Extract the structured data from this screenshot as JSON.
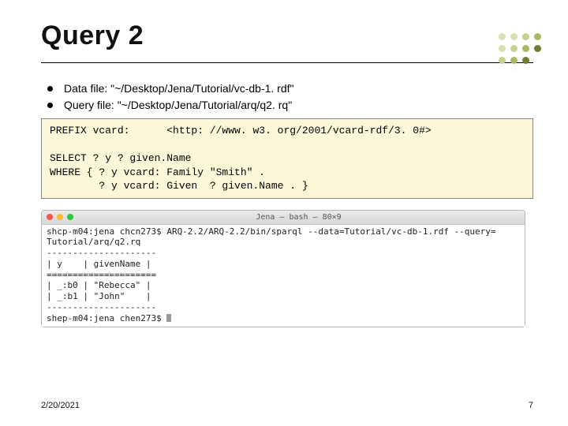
{
  "title": "Query 2",
  "bullets": {
    "data_file": "Data file: \"~/Desktop/Jena/Tutorial/vc-db-1. rdf\"",
    "query_file": "Query file: \"~/Desktop/Jena/Tutorial/arq/q2. rq\""
  },
  "code": "PREFIX vcard:      <http: //www. w3. org/2001/vcard-rdf/3. 0#>\n\nSELECT ? y ? given.Name\nWHERE { ? y vcard: Family \"Smith\" .\n        ? y vcard: Given  ? given.Name . }",
  "terminal": {
    "title": "Jena — bash — 80×9",
    "body": "shcp-m04:jena chcn273$ ARQ-2.2/ARQ-2.2/bin/sparql --data=Tutorial/vc-db-1.rdf --query=\nTutorial/arq/q2.rq\n---------------------\n| y    | givenName |\n=====================\n| _:b0 | \"Rebecca\" |\n| _:b1 | \"John\"    |\n---------------------\nshep-m04:jena chen273$"
  },
  "footer": {
    "date": "2/20/2021",
    "page": "7"
  }
}
